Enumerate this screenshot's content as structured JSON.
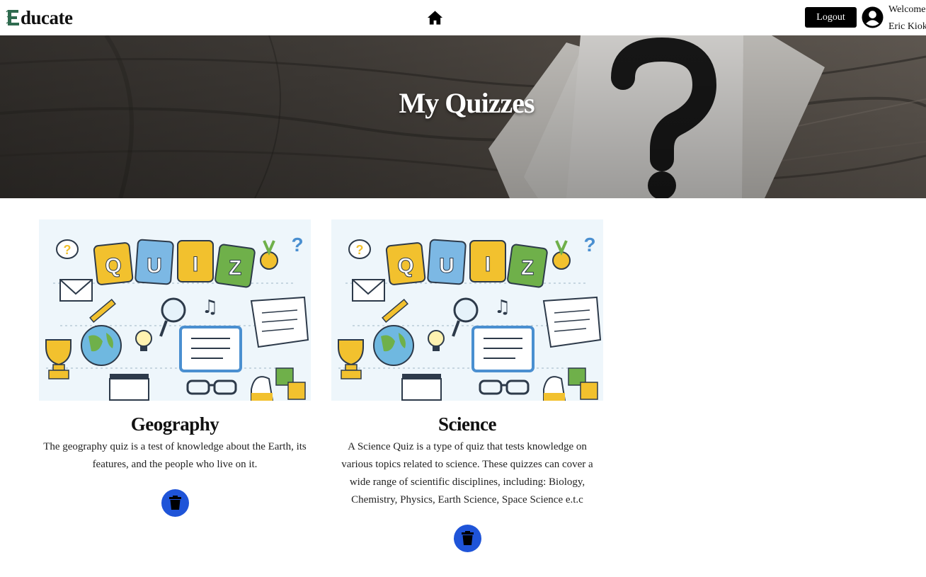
{
  "nav": {
    "logo_letter": "E",
    "logo_text": "ducate",
    "home_icon": "home-icon",
    "logout_label": "Logout",
    "user_icon": "user-circle-icon",
    "welcome_line1": "Welcome",
    "welcome_line2": "Eric Kioko"
  },
  "hero": {
    "title": "My Quizzes"
  },
  "quizzes": [
    {
      "title": "Geography",
      "description": "The geography quiz is a test of knowledge about the Earth, its features, and the people who live on it.",
      "image_text": [
        "Q",
        "U",
        "I",
        "Z"
      ],
      "delete_icon": "trash-icon"
    },
    {
      "title": "Science",
      "description": "A Science Quiz is a type of quiz that tests knowledge on various topics related to science. These quizzes can cover a wide range of scientific disciplines, including: Biology, Chemistry, Physics, Earth Science, Space Science e.t.c",
      "image_text": [
        "Q",
        "U",
        "I",
        "Z"
      ],
      "delete_icon": "trash-icon"
    }
  ],
  "colors": {
    "accent_blue": "#1f54d8",
    "logout_bg": "#000000",
    "quiz_tile_yellow": "#f2c12e",
    "quiz_tile_blue": "#7cb8e4",
    "quiz_tile_green": "#6fb04a"
  }
}
